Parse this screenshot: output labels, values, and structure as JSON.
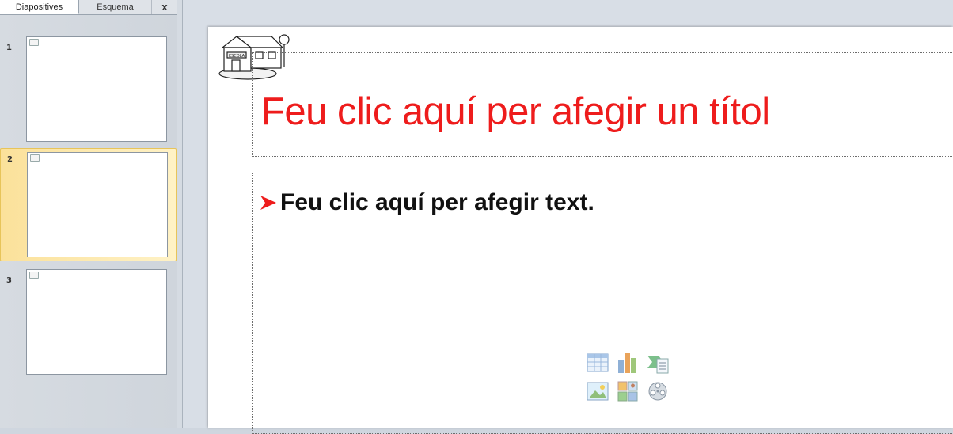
{
  "left_pane": {
    "tabs": [
      {
        "label": "Diapositives",
        "active": true
      },
      {
        "label": "Esquema",
        "active": false
      }
    ],
    "close_label": "x",
    "slides": [
      {
        "number": "1",
        "selected": false
      },
      {
        "number": "2",
        "selected": true
      },
      {
        "number": "3",
        "selected": false
      }
    ]
  },
  "slide": {
    "title_placeholder": "Feu clic aquí per afegir un títol",
    "body_placeholder": "Feu clic aquí per afegir text.",
    "logo_text": "ESCOLA",
    "content_icons": [
      "insert-table-icon",
      "insert-chart-icon",
      "insert-smartart-icon",
      "insert-picture-icon",
      "insert-clipart-icon",
      "insert-media-icon"
    ]
  },
  "colors": {
    "title": "#ee1c1c",
    "bullet": "#ee1c1c",
    "selection": "#fbe19a"
  }
}
